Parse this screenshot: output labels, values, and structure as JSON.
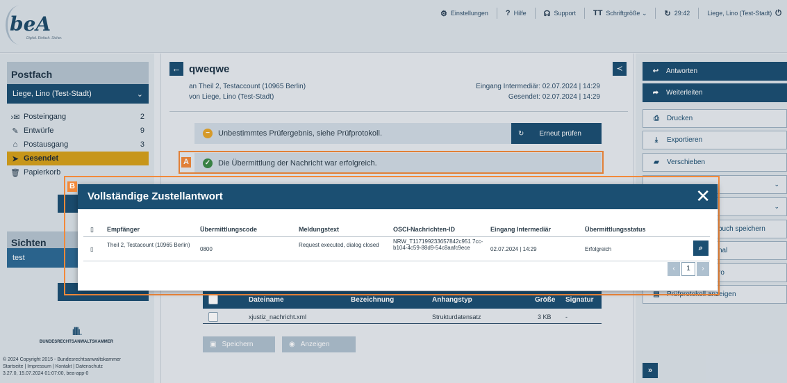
{
  "topbar": {
    "logo_text": "beA",
    "logo_tagline": "Digital. Einfach. Sicher.",
    "items": [
      {
        "icon": "gear-icon",
        "glyph": "⚙",
        "label": "Einstellungen"
      },
      {
        "icon": "help-icon",
        "glyph": "?",
        "label": "Hilfe"
      },
      {
        "icon": "headset-icon",
        "glyph": "☊",
        "label": "Support"
      },
      {
        "icon": "text-size-icon",
        "glyph": "TT",
        "label": "Schriftgröße ⌄"
      },
      {
        "icon": "refresh-icon",
        "glyph": "↻",
        "label": "29:42"
      },
      {
        "icon": "power-icon",
        "glyph": "⏻",
        "label": "Liege, Lino (Test-Stadt)"
      }
    ]
  },
  "sidebar": {
    "postfach_title": "Postfach",
    "mailbox": "Liege, Lino (Test-Stadt)",
    "folders": [
      {
        "label": "Posteingang",
        "count": "2",
        "icon": "inbox-icon",
        "glyph": "›✉"
      },
      {
        "label": "Entwürfe",
        "count": "9",
        "icon": "edit-icon",
        "glyph": "✎"
      },
      {
        "label": "Postausgang",
        "count": "3",
        "icon": "outbox-icon",
        "glyph": "⌂"
      },
      {
        "label": "Gesendet",
        "count": "",
        "icon": "send-icon",
        "glyph": "➤"
      },
      {
        "label": "Papierkorb",
        "count": "",
        "icon": "trash-icon",
        "glyph": "🗑"
      }
    ],
    "sichten_title": "Sichten",
    "sichten_item": "test",
    "brak_logo": "ıllllı.",
    "brak_text": "BUNDESRECHTSANWALTSKAMMER",
    "footer_lines": [
      "© 2024 Copyright 2015 - Bundesrechtsanwaltskammer",
      "Startseite | Impressum | Kontakt | Datenschutz",
      "3.27.0, 15.07.2024 01:07:00, bea-app-0"
    ]
  },
  "message": {
    "subject": "qweqwe",
    "to": "an Theil 2, Testaccount (10965 Berlin)",
    "from": "von Liege, Lino (Test-Stadt)",
    "received": "Eingang Intermediär: 02.07.2024 | 14:29",
    "sent": "Gesendet: 02.07.2024 | 14:29",
    "alert_check": "Unbestimmtes Prüfergebnis, siehe Prüfprotokoll.",
    "recheck_label": "Erneut prüfen",
    "alert_success": "Die Übermittlung der Nachricht war erfolgreich.",
    "highlight_a": "A",
    "highlight_b": "B"
  },
  "attachments": {
    "headers": [
      "Dateiname",
      "Bezeichnung",
      "Anhangstyp",
      "Größe",
      "Signatur"
    ],
    "rows": [
      {
        "filename": "xjustiz_nachricht.xml",
        "bezeichnung": "",
        "typ": "Strukturdatensatz",
        "size": "3 KB",
        "signatur": "-"
      }
    ],
    "save_label": "Speichern",
    "view_label": "Anzeigen"
  },
  "actions": {
    "reply": "Antworten",
    "forward": "Weiterleiten",
    "print": "Drucken",
    "export": "Exportieren",
    "move": "Verschieben",
    "save_partial": "buch speichern",
    "journal_partial": "nal",
    "cert_partial": "ro",
    "protocol_partial": "Prüfprotokoll anzeigen"
  },
  "modal": {
    "title": "Vollständige Zustellantwort",
    "close": "✕",
    "headers": [
      "Empfänger",
      "Übermittlungscode",
      "Meldungstext",
      "OSCI-Nachrichten-ID",
      "Eingang Intermediär",
      "Übermittlungsstatus"
    ],
    "rows": [
      {
        "empfaenger": "Theil 2, Testacount (10965 Berlin)",
        "code": "0800",
        "text": "Request executed, dialog closed",
        "osci": "NRW_T117199233657842c951 7cc-b104-4c59-88d9-54c8aafc9ece",
        "eingang": "02.07.2024 | 14:29",
        "status": "Erfolgreich"
      }
    ],
    "page": "1"
  },
  "colors": {
    "primary": "#1b4f72",
    "accent": "#d6a11a",
    "highlight": "#f2893a",
    "success": "#3a8a47",
    "warning": "#e6a52a"
  }
}
